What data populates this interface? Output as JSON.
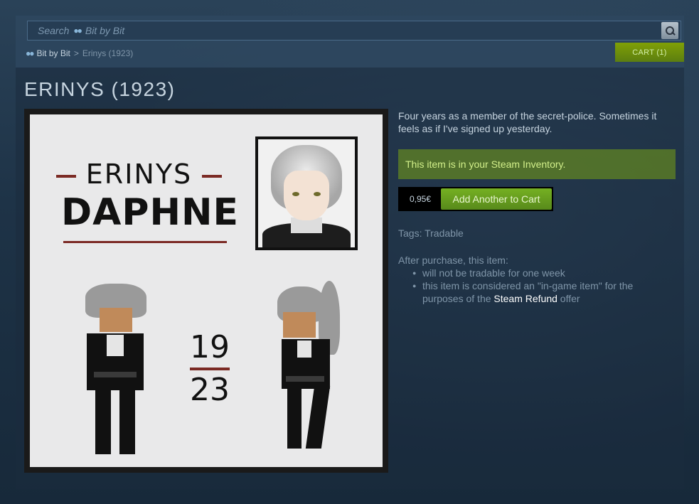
{
  "search": {
    "placeholder": "Search",
    "game_name": "Bit by Bit"
  },
  "breadcrumb": {
    "game": "Bit by Bit",
    "separator": ">",
    "current": "Erinys (1923)"
  },
  "cart": {
    "label": "CART (1)"
  },
  "item": {
    "title": "ERINYS (1923)",
    "image": {
      "top_word": "ERINYS",
      "name_word": "DAPHNE",
      "year_top": "19",
      "year_bottom": "23"
    },
    "description": "Four years as a member of the secret-police. Sometimes it feels as if I've signed up yesterday.",
    "owned_notice": "This item is in your Steam Inventory.",
    "price": "0,95€",
    "add_button": "Add Another to Cart",
    "tags_label": "Tags:",
    "tags": [
      "Tradable"
    ],
    "purchase_heading": "After purchase, this item:",
    "purchase_points": [
      "will not be tradable for one week",
      "this item is considered an \"in-game item\" for the purposes of the"
    ],
    "refund_link": "Steam Refund",
    "refund_suffix": "offer"
  },
  "colors": {
    "background": "#1b2838",
    "accent_green": "#75b022",
    "owned_bg": "#5f7d18",
    "text": "#c6d4df",
    "muted": "#7f95a8"
  }
}
